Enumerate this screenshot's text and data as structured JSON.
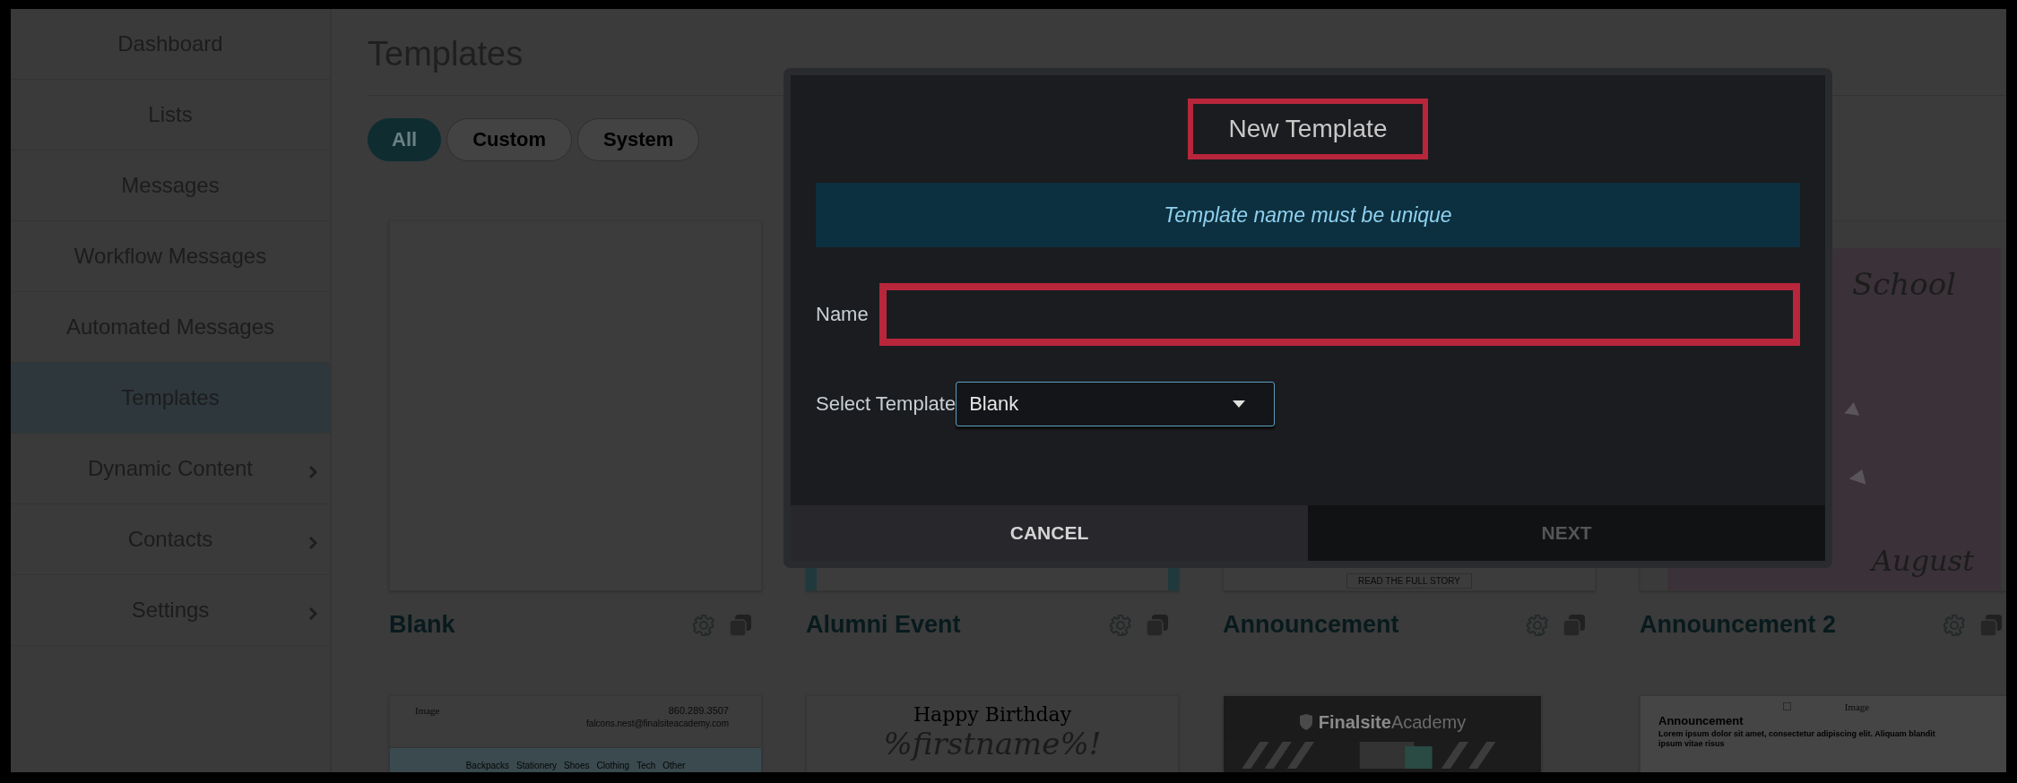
{
  "sidebar": {
    "items": [
      {
        "label": "Dashboard",
        "selected": false,
        "submenu": false
      },
      {
        "label": "Lists",
        "selected": false,
        "submenu": false
      },
      {
        "label": "Messages",
        "selected": false,
        "submenu": false
      },
      {
        "label": "Workflow Messages",
        "selected": false,
        "submenu": false
      },
      {
        "label": "Automated Messages",
        "selected": false,
        "submenu": false
      },
      {
        "label": "Templates",
        "selected": true,
        "submenu": false
      },
      {
        "label": "Dynamic Content",
        "selected": false,
        "submenu": true
      },
      {
        "label": "Contacts",
        "selected": false,
        "submenu": true
      },
      {
        "label": "Settings",
        "selected": false,
        "submenu": true
      }
    ]
  },
  "page": {
    "title": "Templates",
    "filters": [
      {
        "label": "All",
        "selected": true
      },
      {
        "label": "Custom",
        "selected": false
      },
      {
        "label": "System",
        "selected": false
      }
    ]
  },
  "templates": [
    {
      "name": "Blank",
      "thumbnail": {
        "kind": "blank"
      }
    },
    {
      "name": "Alumni Event",
      "thumbnail": {
        "kind": "event"
      }
    },
    {
      "name": "Announcement",
      "thumbnail": {
        "kind": "story",
        "button": "READ THE FULL STORY"
      }
    },
    {
      "name": "Announcement 2",
      "thumbnail": {
        "kind": "floral",
        "heading": "School",
        "footer": "August"
      }
    },
    {
      "thumbnail": {
        "kind": "store",
        "image_alt": "Image",
        "phone": "860.289.3507",
        "email": "falcons.nest@finalsiteacademy.com",
        "nav": [
          "Backpacks",
          "Stationery",
          "Shoes",
          "Clothing",
          "Tech",
          "Other"
        ]
      }
    },
    {
      "thumbnail": {
        "kind": "birthday",
        "line1": "Happy Birthday",
        "line2": "%firstname%!"
      }
    },
    {
      "thumbnail": {
        "kind": "academy",
        "brand_bold": "Finalsite",
        "brand_light": "Academy"
      }
    },
    {
      "thumbnail": {
        "kind": "article",
        "image_alt": "Image",
        "heading": "Announcement",
        "body": "Lorem ipsum dolor sit amet, consectetur adipiscing elit. Aliquam blandit ipsum vitae risus"
      }
    }
  ],
  "dialog": {
    "title": "New Template",
    "title_highlighted": true,
    "notice": "Template name must be unique",
    "name_field": {
      "label": "Name",
      "highlighted": true
    },
    "template_select": {
      "label": "Select Template",
      "value": "Blank"
    },
    "buttons": [
      {
        "label": "CANCEL",
        "kind": "cancel",
        "disabled": false
      },
      {
        "label": "NEXT",
        "kind": "next",
        "disabled": true
      }
    ]
  }
}
